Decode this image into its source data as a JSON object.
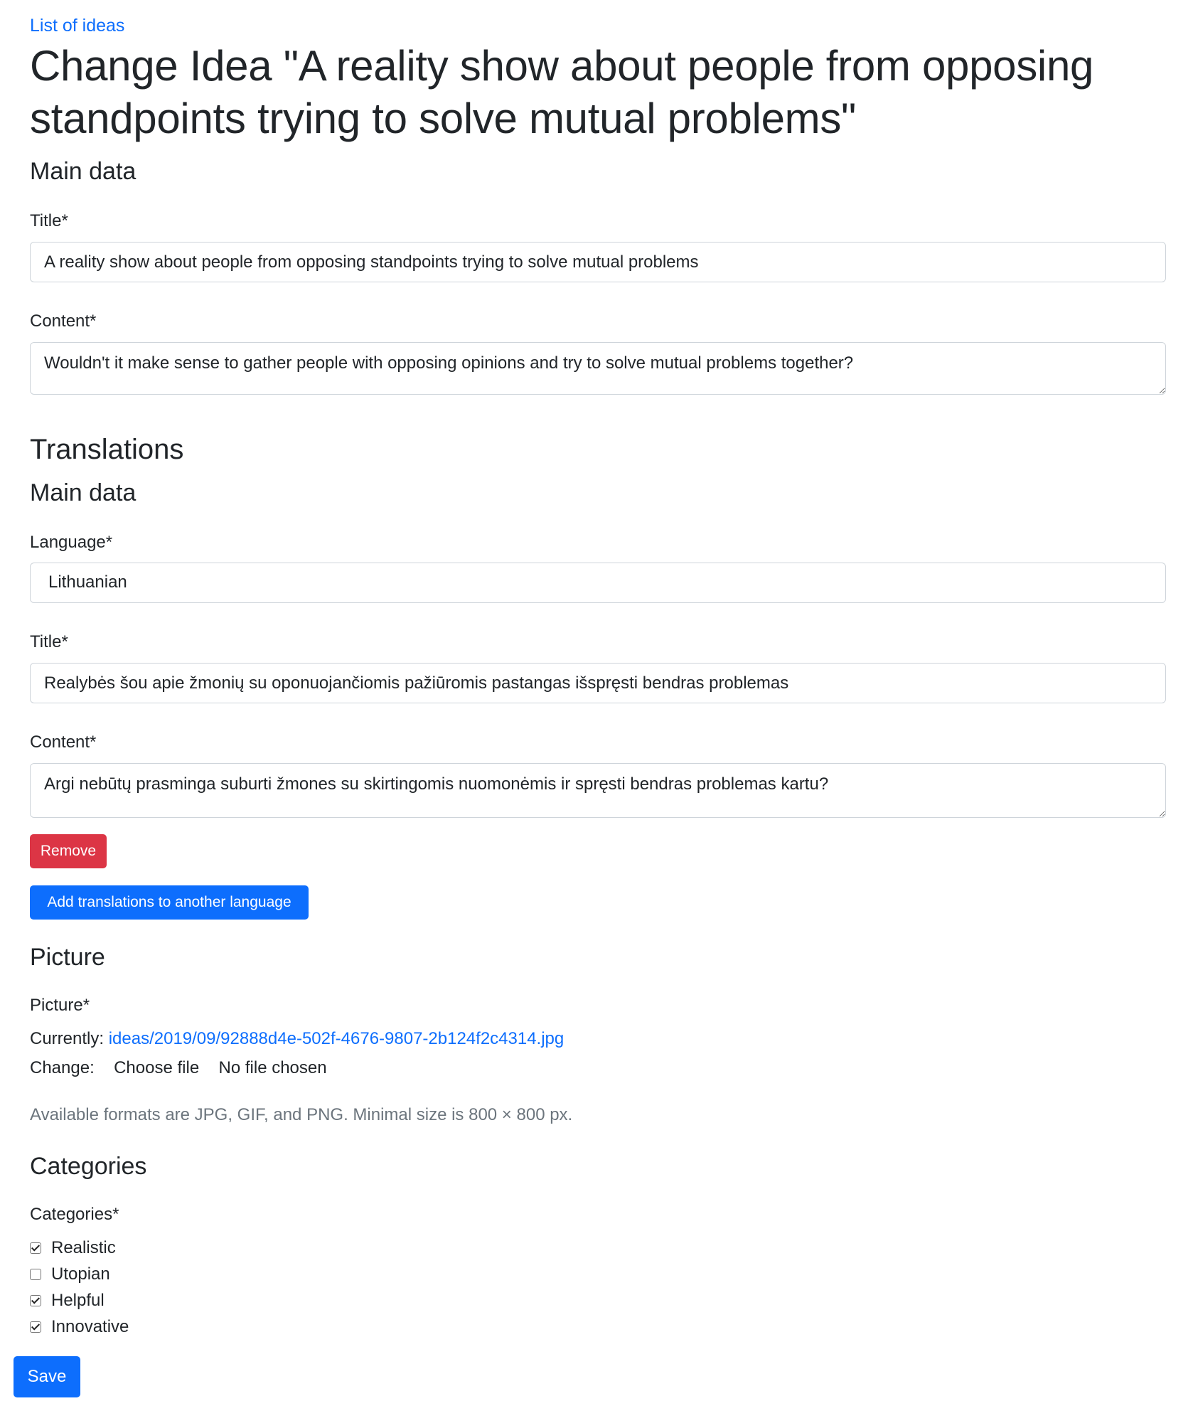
{
  "nav": {
    "back_link": "List of ideas"
  },
  "page_title": "Change Idea \"A reality show about people from opposing standpoints trying to solve mutual problems\"",
  "main_data": {
    "heading": "Main data",
    "title_label": "Title*",
    "title_value": "A reality show about people from opposing standpoints trying to solve mutual problems",
    "content_label": "Content*",
    "content_value": "Wouldn't it make sense to gather people with opposing opinions and try to solve mutual problems together?"
  },
  "translations": {
    "heading": "Translations",
    "subheading": "Main data",
    "language_label": "Language*",
    "language_value": "Lithuanian",
    "title_label": "Title*",
    "title_value": "Realybės šou apie žmonių su oponuojančiomis pažiūromis pastangas išspręsti bendras problemas",
    "content_label": "Content*",
    "content_value": "Argi nebūtų prasminga suburti žmones su skirtingomis nuomonėmis ir spręsti bendras problemas kartu?",
    "remove_button": "Remove",
    "add_button": "Add translations to another language"
  },
  "picture": {
    "heading": "Picture",
    "label": "Picture*",
    "currently_label": "Currently:",
    "current_file": "ideas/2019/09/92888d4e-502f-4676-9807-2b124f2c4314.jpg",
    "change_label": "Change:",
    "choose_file_button": "Choose file",
    "no_file_text": "No file chosen",
    "help_text": "Available formats are JPG, GIF, and PNG. Minimal size is 800 × 800 px."
  },
  "categories": {
    "heading": "Categories",
    "label": "Categories*",
    "items": [
      {
        "label": "Realistic",
        "checked": true
      },
      {
        "label": "Utopian",
        "checked": false
      },
      {
        "label": "Helpful",
        "checked": true
      },
      {
        "label": "Innovative",
        "checked": true
      }
    ]
  },
  "save_button": "Save",
  "colors": {
    "primary": "#0d6efd",
    "danger": "#dc3545",
    "text": "#212529",
    "muted": "#6c757d",
    "border": "#ced4da"
  }
}
